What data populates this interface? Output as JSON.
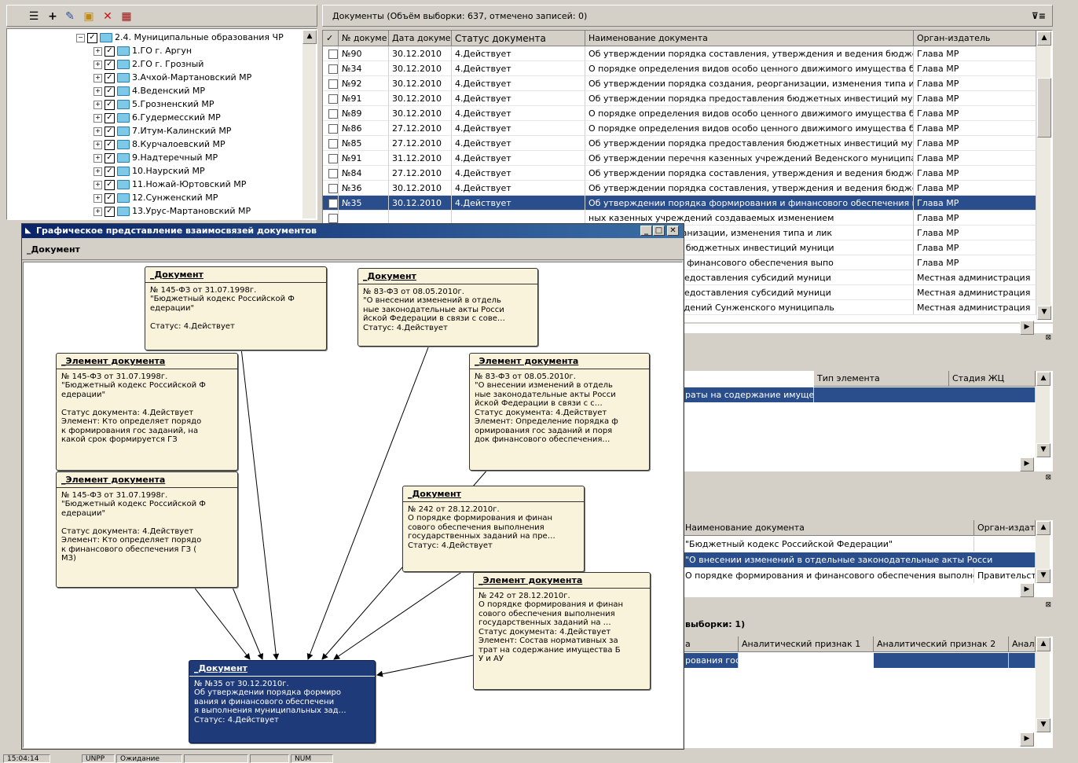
{
  "toolbar": {
    "icons": [
      "list-icon",
      "add-icon",
      "edit-icon",
      "folder-link-icon",
      "delete-icon",
      "calendar-icon"
    ]
  },
  "tree": {
    "root": "2.4. Муниципальные образования ЧР",
    "items": [
      "1.ГО г. Аргун",
      "2.ГО г. Грозный",
      "3.Ачхой-Мартановский МР",
      "4.Веденский МР",
      "5.Грозненский МР",
      "6.Гудермесский МР",
      "7.Итум-Калинский МР",
      "8.Курчалоевский МР",
      "9.Надтеречный МР",
      "10.Наурский МР",
      "11.Ножай-Юртовский МР",
      "12.Сунженский МР",
      "13.Урус-Мартановский МР"
    ]
  },
  "docs": {
    "header": "Документы (Объём выборки: 637, отмечено записей: 0)",
    "columns": [
      "№ докуме",
      "Дата докуме",
      "Статус документа",
      "Наименование документа",
      "Орган-издатель"
    ],
    "rows": [
      {
        "num": "№90",
        "date": "30.12.2010",
        "status": "4.Действует",
        "name": "Об утверждении порядка составления, утверждения и ведения бюджетн",
        "org": "Глава МР"
      },
      {
        "num": "№34",
        "date": "30.12.2010",
        "status": "4.Действует",
        "name": "О порядке определения видов особо ценного движимого имущества бюдж",
        "org": "Глава МР"
      },
      {
        "num": "№92",
        "date": "30.12.2010",
        "status": "4.Действует",
        "name": "Об утверждении порядка создания, реорганизации, изменения типа и лик",
        "org": "Глава МР"
      },
      {
        "num": "№91",
        "date": "30.12.2010",
        "status": "4.Действует",
        "name": "Об утверждении порядка предоставления бюджетных инвестиций муници",
        "org": "Глава МР"
      },
      {
        "num": "№89",
        "date": "30.12.2010",
        "status": "4.Действует",
        "name": "О порядке определения видов особо ценного движимого имущества бюдж",
        "org": "Глава МР"
      },
      {
        "num": "№86",
        "date": "27.12.2010",
        "status": "4.Действует",
        "name": "О порядке определения видов особо ценного движимого имущества бюдж",
        "org": "Глава МР"
      },
      {
        "num": "№85",
        "date": "27.12.2010",
        "status": "4.Действует",
        "name": "Об утверждении порядка предоставления бюджетных инвестиций муници",
        "org": "Глава МР"
      },
      {
        "num": "№91",
        "date": "31.12.2010",
        "status": "4.Действует",
        "name": "Об утверждении перечня казенных учреждений Веденского муниципальн",
        "org": "Глава МР"
      },
      {
        "num": "№84",
        "date": "27.12.2010",
        "status": "4.Действует",
        "name": "Об утверждении порядка составления, утверждения и ведения бюджетн",
        "org": "Глава МР"
      },
      {
        "num": "№36",
        "date": "30.12.2010",
        "status": "4.Действует",
        "name": "Об утверждении порядка составления, утверждения и ведения бюджетн",
        "org": "Глава МР"
      },
      {
        "num": "№35",
        "date": "30.12.2010",
        "status": "4.Действует",
        "name": "Об утверждении порядка формирования и финансового обеспечения выпо",
        "org": "Глава МР"
      },
      {
        "num": "",
        "date": "",
        "status": "",
        "name": "ных казенных учреждений создаваемых изменением",
        "org": "Глава МР"
      },
      {
        "num": "",
        "date": "",
        "status": "",
        "name": "дка создания, реорганизации, изменения типа и лик",
        "org": "Глава МР"
      },
      {
        "num": "",
        "date": "",
        "status": "",
        "name": "дка предоставления бюджетных инвестиций муници",
        "org": "Глава МР"
      },
      {
        "num": "",
        "date": "",
        "status": "",
        "name": "дка формирования и финансового обеспечения выпо",
        "org": "Глава МР"
      },
      {
        "num": "",
        "date": "",
        "status": "",
        "name": "объема и условий предоставления субсидий муници",
        "org": "Местная администрация"
      },
      {
        "num": "",
        "date": "",
        "status": "",
        "name": "объема и условий предоставления субсидий муници",
        "org": "Местная администрация"
      },
      {
        "num": "",
        "date": "",
        "status": "",
        "name": "ных казенных учреждений Сунженского муниципаль",
        "org": "Местная администрация"
      }
    ]
  },
  "panel2": {
    "columns": [
      "Тип элемента",
      "Стадия ЖЦ"
    ],
    "row": "раты на содержание имущест"
  },
  "panel3": {
    "columns": [
      "Наименование документа",
      "Орган-издат"
    ],
    "rows": [
      {
        "name": "\"Бюджетный кодекс Российской Федерации\"",
        "org": ""
      },
      {
        "name": "\"О внесении изменений в отдельные законодательные акты Росси",
        "org": ""
      },
      {
        "name": "О порядке формирования и финансового обеспечения выполнения",
        "org": "Правительст"
      }
    ]
  },
  "panel4": {
    "title": "выборки: 1)",
    "columns": [
      "а",
      "Аналитический признак 1",
      "Аналитический признак 2",
      "Анал"
    ],
    "row": "рования гос"
  },
  "dialog": {
    "title": "Графическое представление взаимосвязей документов",
    "subtitle": "_Документ",
    "nodes": [
      {
        "id": "n1",
        "title": "_Документ",
        "body": "№ 145-ФЗ от 31.07.1998г.\n\"Бюджетный кодекс Российской Ф\nедерации\"\n\nСтатус: 4.Действует"
      },
      {
        "id": "n2",
        "title": "_Документ",
        "body": "№ 83-ФЗ от 08.05.2010г.\n\"О внесении изменений в отдель\nные законодательные акты Росси\nйской Федерации в связи с сове…\nСтатус: 4.Действует"
      },
      {
        "id": "n3",
        "title": "_Элемент документа",
        "body": "№ 145-ФЗ от 31.07.1998г.\n\"Бюджетный кодекс Российской Ф\nедерации\"\n\nСтатус документа: 4.Действует\nЭлемент: Кто определяет порядо\nк формирования гос заданий, на\n какой срок формируется ГЗ"
      },
      {
        "id": "n4",
        "title": "_Элемент документа",
        "body": "№ 83-ФЗ от 08.05.2010г.\n\"О внесении изменений в отдель\nные законодательные акты Росси\nйской Федерации в связи с с…\nСтатус документа: 4.Действует\nЭлемент: Определение порядка ф\nормирования гос заданий и поря\nдок финансового обеспечения…"
      },
      {
        "id": "n5",
        "title": "_Элемент документа",
        "body": "№ 145-ФЗ от 31.07.1998г.\n\"Бюджетный кодекс Российской Ф\nедерации\"\n\nСтатус документа: 4.Действует\nЭлемент: Кто определяет порядо\nк финансового обеспечения ГЗ (\nМЗ)"
      },
      {
        "id": "n6",
        "title": "_Документ",
        "body": "№ 242 от 28.12.2010г.\nО порядке формирования и финан\nсового обеспечения выполнения\nгосударственных заданий на пре…\nСтатус: 4.Действует"
      },
      {
        "id": "n7",
        "title": "_Элемент документа",
        "body": "№ 242 от 28.12.2010г.\nО порядке формирования и финан\nсового обеспечения выполнения\nгосударственных заданий на …\nСтатус документа: 4.Действует\nЭлемент: Состав нормативных за\nтрат на содержание имущества Б\nУ и АУ"
      },
      {
        "id": "n8",
        "title": "_Документ",
        "body": "№ №35 от 30.12.2010г.\nОб утверждении порядка формиро\nвания и финансового обеспечени\nя выполнения муниципальных зад…\nСтатус: 4.Действует"
      }
    ]
  },
  "statusbar": {
    "cells": [
      "15:04:14",
      "UNPP",
      "Ожидание",
      "",
      "",
      "NUM"
    ]
  },
  "colors": {
    "selection": "#2a4d8c",
    "node_fill": "#faf3dc",
    "node_dark": "#1e3a78",
    "title_bar": "#0a246a"
  }
}
